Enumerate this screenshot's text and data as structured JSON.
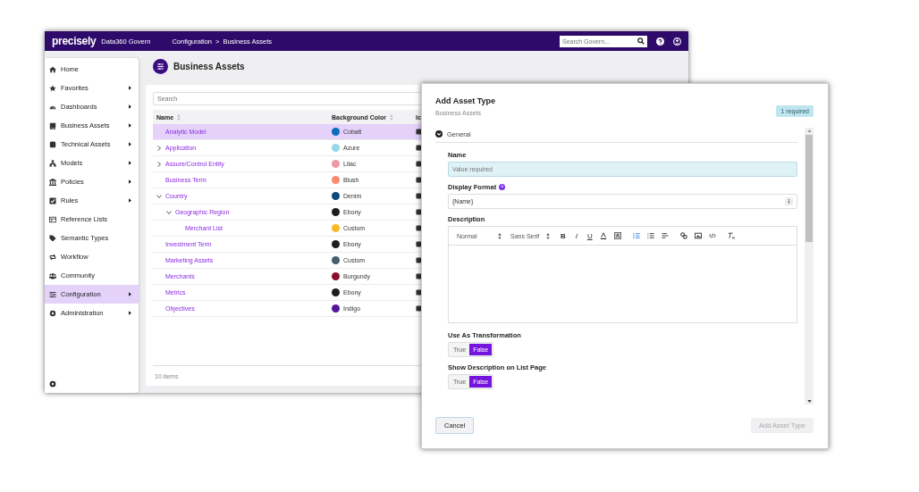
{
  "app": {
    "logo": "precisely",
    "product": "Data360 Govern",
    "breadcrumb": [
      "Configuration",
      "Business Assets"
    ],
    "breadcrumb_separator": ">",
    "search": {
      "placeholder": "Search Govern..."
    }
  },
  "sidebar": {
    "items": [
      {
        "label": "Home",
        "kind": "home",
        "submenu": false,
        "selected": false
      },
      {
        "label": "Favorites",
        "kind": "star",
        "submenu": true,
        "selected": false
      },
      {
        "label": "Dashboards",
        "kind": "gauge",
        "submenu": true,
        "selected": false
      },
      {
        "label": "Business Assets",
        "kind": "book",
        "submenu": true,
        "selected": false
      },
      {
        "label": "Technical Assets",
        "kind": "database",
        "submenu": true,
        "selected": false
      },
      {
        "label": "Models",
        "kind": "hierarchy",
        "submenu": true,
        "selected": false
      },
      {
        "label": "Policies",
        "kind": "bank",
        "submenu": true,
        "selected": false
      },
      {
        "label": "Rules",
        "kind": "checkbox",
        "submenu": true,
        "selected": false
      },
      {
        "label": "Reference Lists",
        "kind": "table",
        "submenu": false,
        "selected": false
      },
      {
        "label": "Semantic Types",
        "kind": "tag",
        "submenu": false,
        "selected": false
      },
      {
        "label": "Workflow",
        "kind": "cycle",
        "submenu": false,
        "selected": false
      },
      {
        "label": "Community",
        "kind": "people",
        "submenu": false,
        "selected": false
      },
      {
        "label": "Configuration",
        "kind": "sliders",
        "submenu": true,
        "selected": true
      },
      {
        "label": "Administration",
        "kind": "gear",
        "submenu": true,
        "selected": false
      }
    ]
  },
  "page": {
    "title": "Business Assets",
    "search": {
      "placeholder": "Search"
    },
    "table": {
      "columns": [
        "Name",
        "Background Color",
        "Ic"
      ],
      "rows": [
        {
          "name": "Analytic Model",
          "kind": "leaf",
          "color": "#0a6ebd",
          "color_name": "Cobalt",
          "selected": true
        },
        {
          "name": "Application",
          "kind": "group",
          "expanded": false,
          "color": "#93d8e6",
          "color_name": "Azure",
          "selected": false
        },
        {
          "name": "Assure/Control Entity",
          "kind": "group",
          "expanded": false,
          "color": "#ec9aaa",
          "color_name": "Lilac",
          "selected": false
        },
        {
          "name": "Business Term",
          "kind": "leaf",
          "color": "#fa8a70",
          "color_name": "Blush",
          "selected": false
        },
        {
          "name": "Country",
          "kind": "group",
          "expanded": true,
          "color": "#0b4a7a",
          "color_name": "Denim",
          "selected": false,
          "children": [
            {
              "name": "Geographic Region",
              "kind": "group",
              "expanded": true,
              "color": "#1e1e1e",
              "color_name": "Ebony",
              "selected": false,
              "children": [
                {
                  "name": "Merchant List",
                  "kind": "leaf",
                  "color": "#fbb928",
                  "color_name": "Custom",
                  "selected": false
                }
              ]
            }
          ]
        },
        {
          "name": "Investment Term",
          "kind": "leaf",
          "color": "#1e1e1e",
          "color_name": "Ebony",
          "selected": false
        },
        {
          "name": "Marketing Assets",
          "kind": "leaf",
          "color": "#455f6c",
          "color_name": "Custom",
          "selected": false
        },
        {
          "name": "Merchants",
          "kind": "leaf",
          "color": "#8a0f2e",
          "color_name": "Burgundy",
          "selected": false
        },
        {
          "name": "Metrics",
          "kind": "leaf",
          "color": "#1e1e1e",
          "color_name": "Ebony",
          "selected": false
        },
        {
          "name": "Objectives",
          "kind": "leaf",
          "color": "#55179a",
          "color_name": "Indigo",
          "selected": false
        }
      ],
      "footer": "10 items"
    }
  },
  "dialog": {
    "title": "Add Asset Type",
    "subtitle": "Business Assets",
    "badge": "1 required",
    "section": {
      "label": "General",
      "expanded": true
    },
    "name": {
      "label": "Name",
      "placeholder": "Value required"
    },
    "display_format": {
      "label": "Display Format",
      "value": "{Name}"
    },
    "description": {
      "label": "Description",
      "style_select": "Normal",
      "font_select": "Sans Serif",
      "buttons": [
        "B",
        "I",
        "U"
      ]
    },
    "toggles": [
      {
        "label": "Use As Transformation",
        "options": [
          {
            "label": "True",
            "selected": false
          },
          {
            "label": "False",
            "selected": true
          }
        ]
      },
      {
        "label": "Show Description on List Page",
        "options": [
          {
            "label": "True",
            "selected": false
          },
          {
            "label": "False",
            "selected": true
          }
        ]
      }
    ],
    "cancel": "Cancel",
    "submit": {
      "label": "Add Asset Type",
      "disabled": true
    }
  }
}
